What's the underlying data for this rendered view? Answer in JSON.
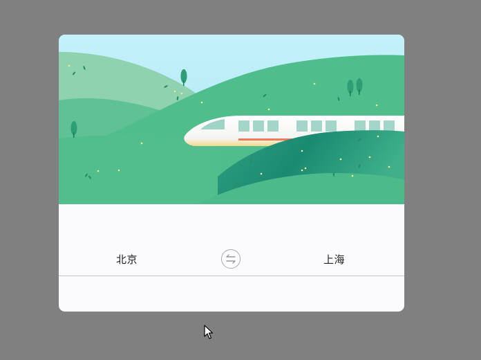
{
  "route": {
    "from_city": "北京",
    "to_city": "上海"
  },
  "icons": {
    "swap": "swap-arrows-icon",
    "cursor": "mouse-pointer-icon"
  },
  "colors": {
    "page_background": "#808080",
    "card_background": "#fbfbfd",
    "sky": "#bff0f9",
    "hill_green": "#4fbe8c",
    "train_window": "#9fd3c6",
    "train_stripe": "#f07a5a"
  }
}
